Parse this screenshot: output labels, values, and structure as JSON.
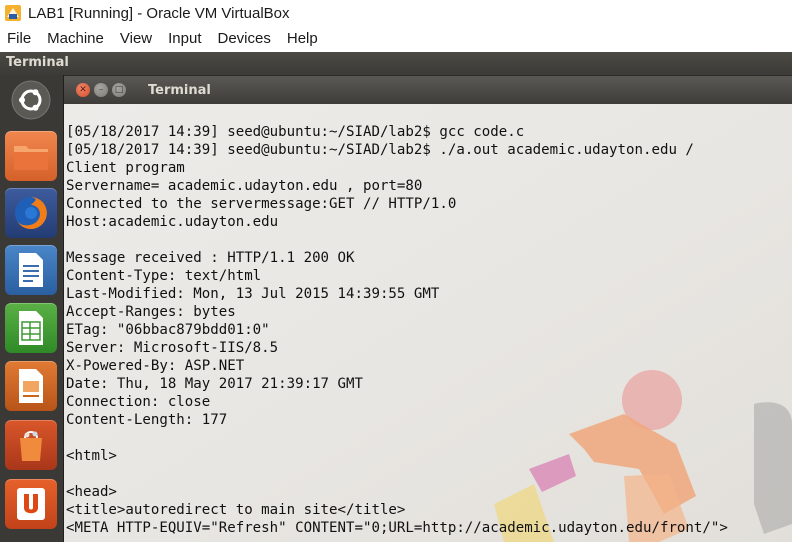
{
  "host": {
    "title": "LAB1 [Running] - Oracle VM VirtualBox",
    "menu": [
      "File",
      "Machine",
      "View",
      "Input",
      "Devices",
      "Help"
    ]
  },
  "guest": {
    "panel_title": "Terminal",
    "launcher_items": [
      "ubuntu-dash-icon",
      "files-icon",
      "firefox-icon",
      "writer-icon",
      "calc-icon",
      "impress-icon",
      "software-center-icon",
      "ubuntu-one-icon"
    ]
  },
  "terminal": {
    "title": "Terminal",
    "lines": [
      "[05/18/2017 14:39] seed@ubuntu:~/SIAD/lab2$ gcc code.c",
      "[05/18/2017 14:39] seed@ubuntu:~/SIAD/lab2$ ./a.out academic.udayton.edu /",
      "Client program",
      "Servername= academic.udayton.edu , port=80",
      "Connected to the servermessage:GET // HTTP/1.0",
      "Host:academic.udayton.edu",
      "",
      "Message received : HTTP/1.1 200 OK",
      "Content-Type: text/html",
      "Last-Modified: Mon, 13 Jul 2015 14:39:55 GMT",
      "Accept-Ranges: bytes",
      "ETag: \"06bbac879bdd01:0\"",
      "Server: Microsoft-IIS/8.5",
      "X-Powered-By: ASP.NET",
      "Date: Thu, 18 May 2017 21:39:17 GMT",
      "Connection: close",
      "Content-Length: 177",
      "",
      "<html>",
      "",
      "<head>",
      "<title>autoredirect to main site</title>",
      "<META HTTP-EQUIV=\"Refresh\" CONTENT=\"0;URL=http://academic.udayton.edu/front/\">"
    ]
  },
  "colors": {
    "panel": "#3c3b37",
    "close_button": "#e05a37",
    "terminal_bg": "#ecebe8",
    "terminal_text": "#111111"
  }
}
